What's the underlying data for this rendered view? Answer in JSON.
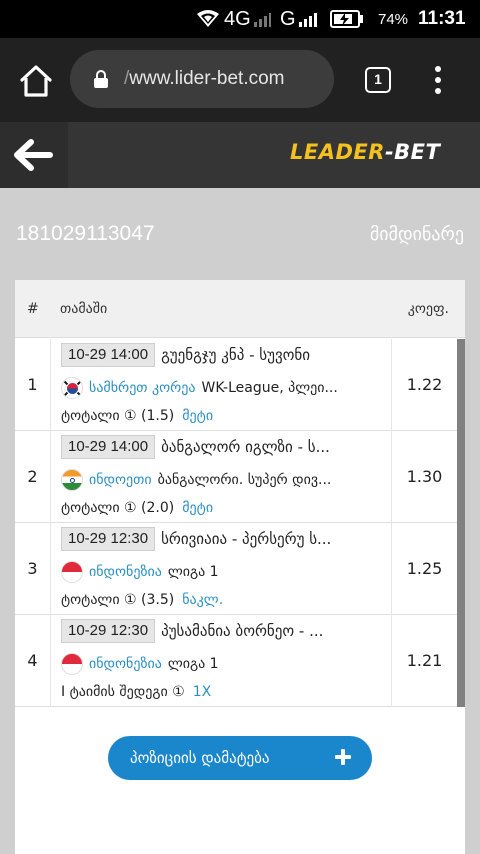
{
  "status_bar": {
    "network": "4G",
    "network2": "G",
    "battery_percent": "74%",
    "time": "11:31"
  },
  "browser": {
    "url": "www.lider-bet.com",
    "tab_count": "1"
  },
  "site": {
    "logo_part1": "LEADER",
    "logo_part2": "-BET"
  },
  "ticket": {
    "id": "181029113047",
    "status": "მიმდინარე"
  },
  "table": {
    "headers": {
      "num": "#",
      "game": "თამაში",
      "coef": "კოეფ."
    },
    "rows": [
      {
        "num": "1",
        "date": "10-29 14:00",
        "match": "გუენგჯუ კნპ - სუვონი",
        "flag": "south-korea-flag-icon",
        "country": "სამხრეთ კორეა",
        "league": "WK-League, პლეი...",
        "bet_type": "ტოტალი ① (1.5)",
        "bet_value": "მეტი",
        "coef": "1.22"
      },
      {
        "num": "2",
        "date": "10-29 14:00",
        "match": "ბანგალორ იგლზი - ს...",
        "flag": "india-flag-icon",
        "country": "ინდოეთი",
        "league": "ბანგალორი. სუპერ დივ...",
        "bet_type": "ტოტალი ① (2.0)",
        "bet_value": "მეტი",
        "coef": "1.30"
      },
      {
        "num": "3",
        "date": "10-29 12:30",
        "match": "სრივიაია - პერსერუ ს...",
        "flag": "indonesia-flag-icon",
        "country": "ინდონეზია",
        "league": "ლიგა 1",
        "bet_type": "ტოტალი ① (3.5)",
        "bet_value": "ნაკლ.",
        "coef": "1.25"
      },
      {
        "num": "4",
        "date": "10-29 12:30",
        "match": "პუსამანია ბორნეო - ...",
        "flag": "indonesia-flag-icon",
        "country": "ინდონეზია",
        "league": "ლიგა 1",
        "bet_type": "I ტაიმის შედეგი ①",
        "bet_value": "1X",
        "coef": "1.21"
      }
    ]
  },
  "add_position_label": "პოზიციის დამატება",
  "colors": {
    "accent_blue": "#1a87cc",
    "logo_yellow": "#f4c11e",
    "link_blue": "#2a8fc4"
  }
}
